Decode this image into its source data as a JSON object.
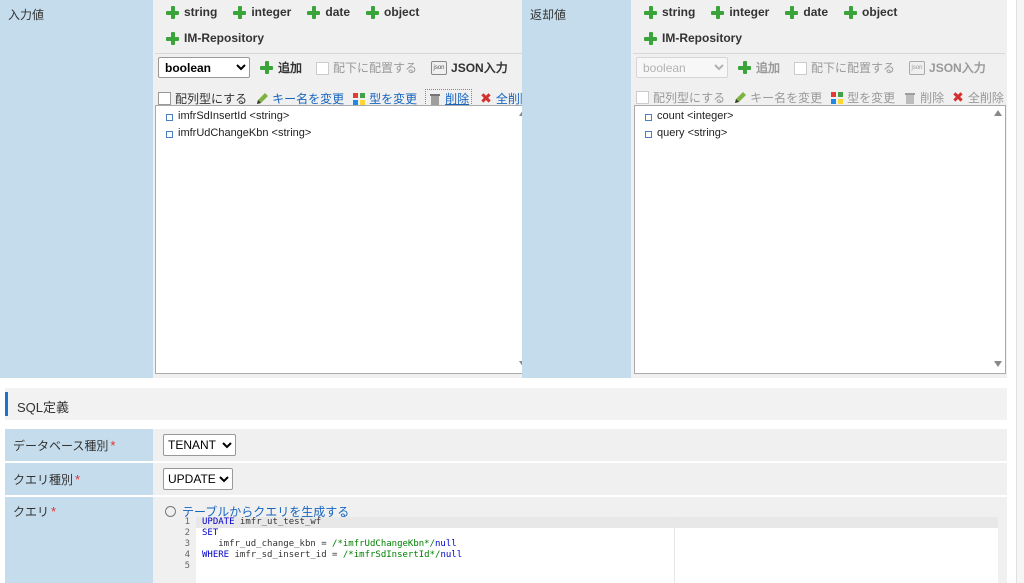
{
  "input_section": {
    "label": "入力値",
    "types": [
      "string",
      "integer",
      "date",
      "object"
    ],
    "repo_label": "IM-Repository",
    "selected_type": "boolean",
    "add_label": "追加",
    "place_under_label": "配下に配置する",
    "json_input_label": "JSON入力",
    "array_type_label": "配列型にする",
    "rename_key_label": "キー名を変更",
    "change_type_label": "型を変更",
    "delete_label": "削除",
    "delete_all_label": "全削除",
    "items": [
      "imfrSdInsertId <string>",
      "imfrUdChangeKbn <string>"
    ]
  },
  "return_section": {
    "label": "返却値",
    "types": [
      "string",
      "integer",
      "date",
      "object"
    ],
    "repo_label": "IM-Repository",
    "selected_type": "boolean",
    "add_label": "追加",
    "place_under_label": "配下に配置する",
    "json_input_label": "JSON入力",
    "array_type_label": "配列型にする",
    "rename_key_label": "キー名を変更",
    "change_type_label": "型を変更",
    "delete_label": "削除",
    "delete_all_label": "全削除",
    "items": [
      "count <integer>",
      "query <string>"
    ]
  },
  "sql_section": {
    "title": "SQL定義",
    "db_type_label": "データベース種別",
    "db_type_value": "TENANT",
    "query_type_label": "クエリ種別",
    "query_type_value": "UPDATE",
    "query_label": "クエリ",
    "generate_link": "テーブルからクエリを生成する",
    "code_lines": [
      {
        "n": "1",
        "kw": "UPDATE",
        "rest": " imfr_ut_test_wf"
      },
      {
        "n": "2",
        "kw": "SET",
        "rest": ""
      },
      {
        "n": "3",
        "kw": "",
        "rest": "   imfr_ud_change_kbn = "
      },
      {
        "n": "4",
        "kw": "WHERE",
        "rest": " imfr_sd_insert_id = "
      },
      {
        "n": "5",
        "kw": "",
        "rest": ""
      }
    ],
    "code_comment_3": "/*imfrUdChangeKbn*/",
    "code_comment_4": "/*imfrSdInsertId*/",
    "code_null": "null"
  },
  "colors": {
    "label_bg": "#c5dcec",
    "panel_bg": "#f0f0f0",
    "accent_bar": "#1a73c8",
    "link": "#1565c0",
    "plus_green": "#3aa33a",
    "required": "#e0302f"
  }
}
